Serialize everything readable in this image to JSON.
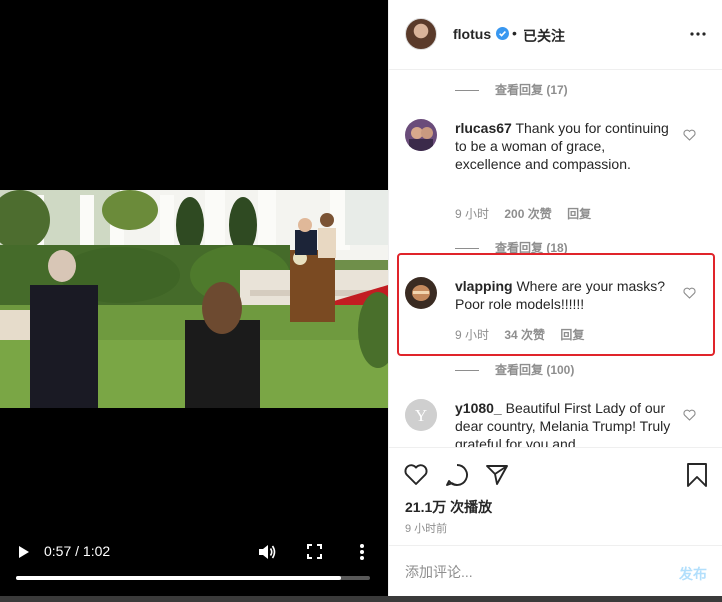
{
  "video": {
    "time_display": "0:57 / 1:02",
    "progress": 0.919,
    "icons": [
      "play-icon",
      "volume-icon",
      "fullscreen-icon",
      "more-vertical-icon"
    ]
  },
  "header": {
    "username": "flotus",
    "separator": "•",
    "follow_status": "已关注",
    "verified_color": "#3897f0"
  },
  "comments": {
    "reply_toggles": [
      "查看回复 (17)",
      "查看回复 (18)",
      "查看回复 (100)"
    ],
    "items": [
      {
        "username": "rlucas67",
        "text": "Thank you for continuing to be a woman of grace, excellence and compassion.",
        "time": "9 小时",
        "likes": "200 次赞",
        "reply_label": "回复"
      },
      {
        "username": "vlapping",
        "text": "Where are your masks? Poor role models!!!!!!",
        "time": "9 小时",
        "likes": "34 次赞",
        "reply_label": "回复"
      },
      {
        "username": "y1080_",
        "text": "Beautiful First Lady of our dear country, Melania Trump! Truly grateful for you and",
        "avatar_letter": "Y"
      }
    ],
    "highlight_color": "#e0242a"
  },
  "actions": {
    "icons": [
      "heart-icon",
      "comment-icon",
      "share-icon",
      "bookmark-icon"
    ],
    "views": "21.1万 次播放",
    "posted": "9 小时前"
  },
  "comment_box": {
    "placeholder": "添加评论...",
    "post_label": "发布"
  }
}
